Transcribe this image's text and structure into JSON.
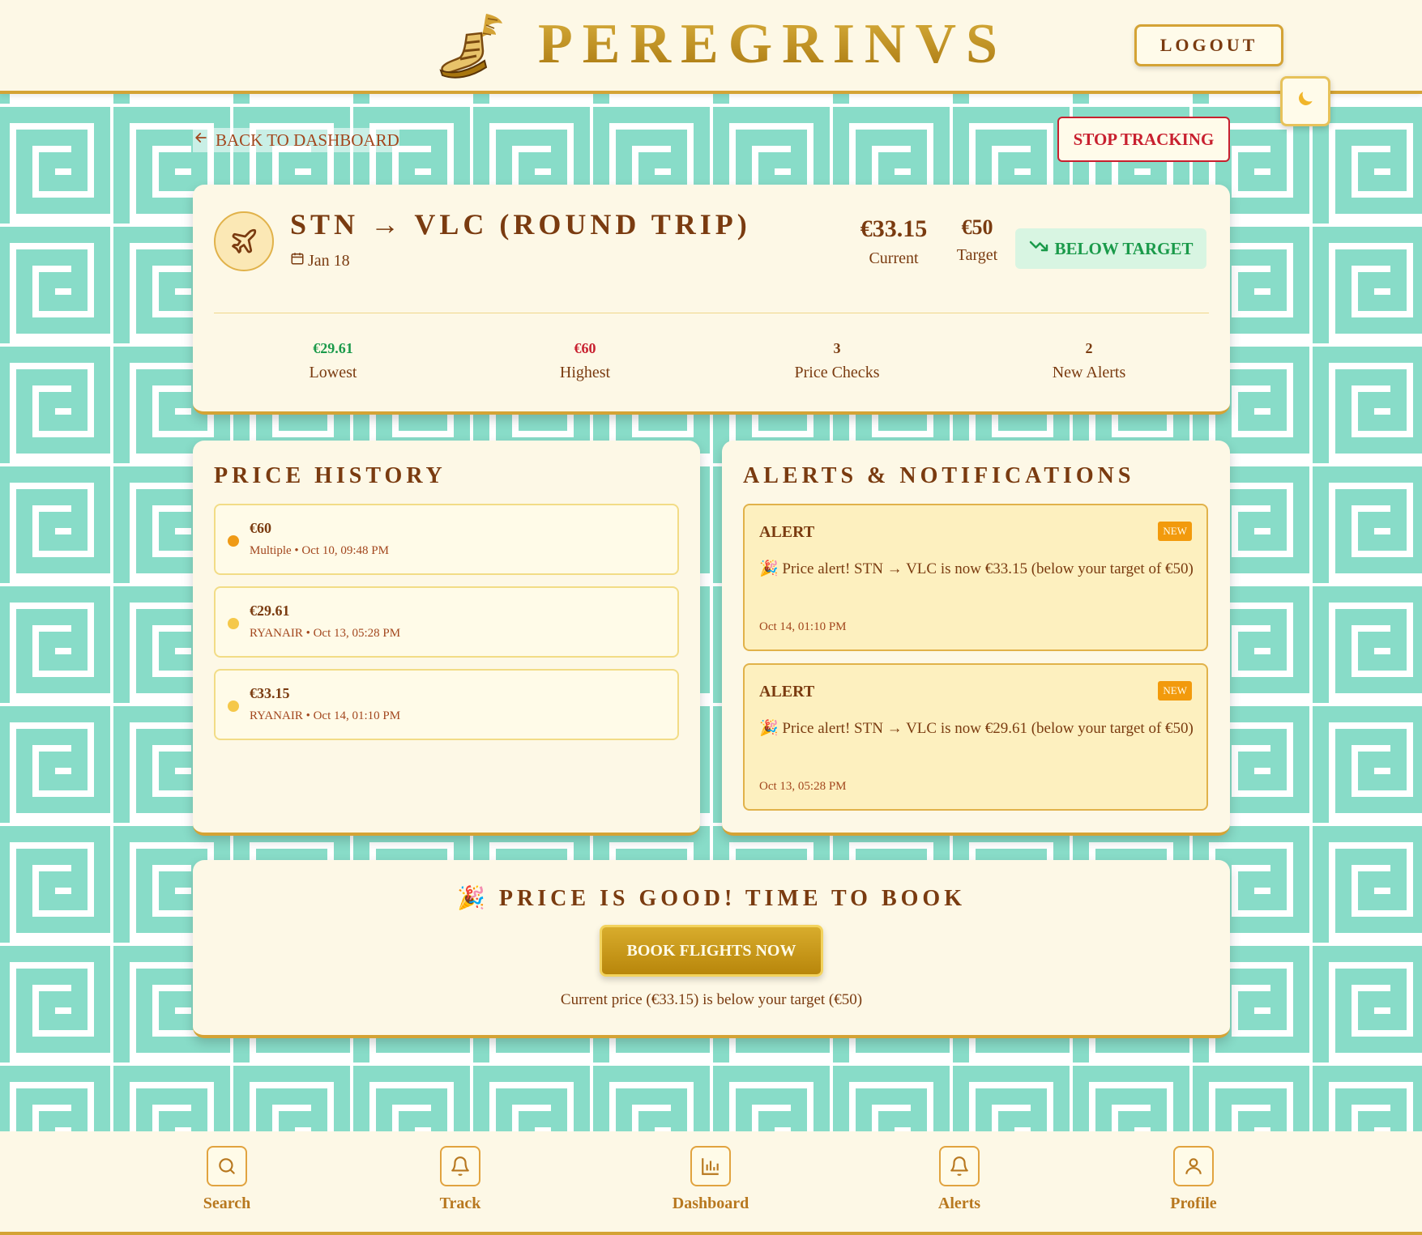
{
  "header": {
    "brand": "PEREGRINVS",
    "logout_label": "LOGOUT",
    "theme_icon": "moon-icon"
  },
  "actions": {
    "back_label": "BACK TO DASHBOARD",
    "stop_label": "STOP TRACKING"
  },
  "summary": {
    "route": "STN → VLC (ROUND TRIP)",
    "date": "Jan 18",
    "current_price": "€33.15",
    "current_label": "Current",
    "target_price": "€50",
    "target_label": "Target",
    "status_badge": "BELOW TARGET",
    "stats": [
      {
        "value": "€29.61",
        "label": "Lowest",
        "color": "#1a9a4a"
      },
      {
        "value": "€60",
        "label": "Highest",
        "color": "#c8202f"
      },
      {
        "value": "3",
        "label": "Price Checks",
        "color": "#7a3b10"
      },
      {
        "value": "2",
        "label": "New Alerts",
        "color": "#7a3b10"
      }
    ]
  },
  "price_history": {
    "title": "PRICE HISTORY",
    "items": [
      {
        "price": "€60",
        "meta": "Multiple • Oct 10, 09:48 PM",
        "dot_color": "#ef9a16"
      },
      {
        "price": "€29.61",
        "meta": "RYANAIR • Oct 13, 05:28 PM",
        "dot_color": "#f5c84a"
      },
      {
        "price": "€33.15",
        "meta": "RYANAIR • Oct 14, 01:10 PM",
        "dot_color": "#f5c84a"
      }
    ]
  },
  "alerts": {
    "title": "ALERTS & NOTIFICATIONS",
    "items": [
      {
        "heading": "ALERT",
        "badge": "NEW",
        "message": "🎉 Price alert! STN → VLC is now €33.15 (below your target of €50)",
        "time": "Oct 14, 01:10 PM"
      },
      {
        "heading": "ALERT",
        "badge": "NEW",
        "message": "🎉 Price alert! STN → VLC is now €29.61 (below your target of €50)",
        "time": "Oct 13, 05:28 PM"
      }
    ]
  },
  "book": {
    "title": "🎉 PRICE IS GOOD! TIME TO BOOK",
    "button_label": "BOOK FLIGHTS NOW",
    "note": "Current price (€33.15) is below your target (€50)"
  },
  "nav": [
    {
      "label": "Search",
      "icon": "search-icon"
    },
    {
      "label": "Track",
      "icon": "bell-icon"
    },
    {
      "label": "Dashboard",
      "icon": "bar-chart-icon"
    },
    {
      "label": "Alerts",
      "icon": "bell-icon"
    },
    {
      "label": "Profile",
      "icon": "user-icon"
    }
  ]
}
